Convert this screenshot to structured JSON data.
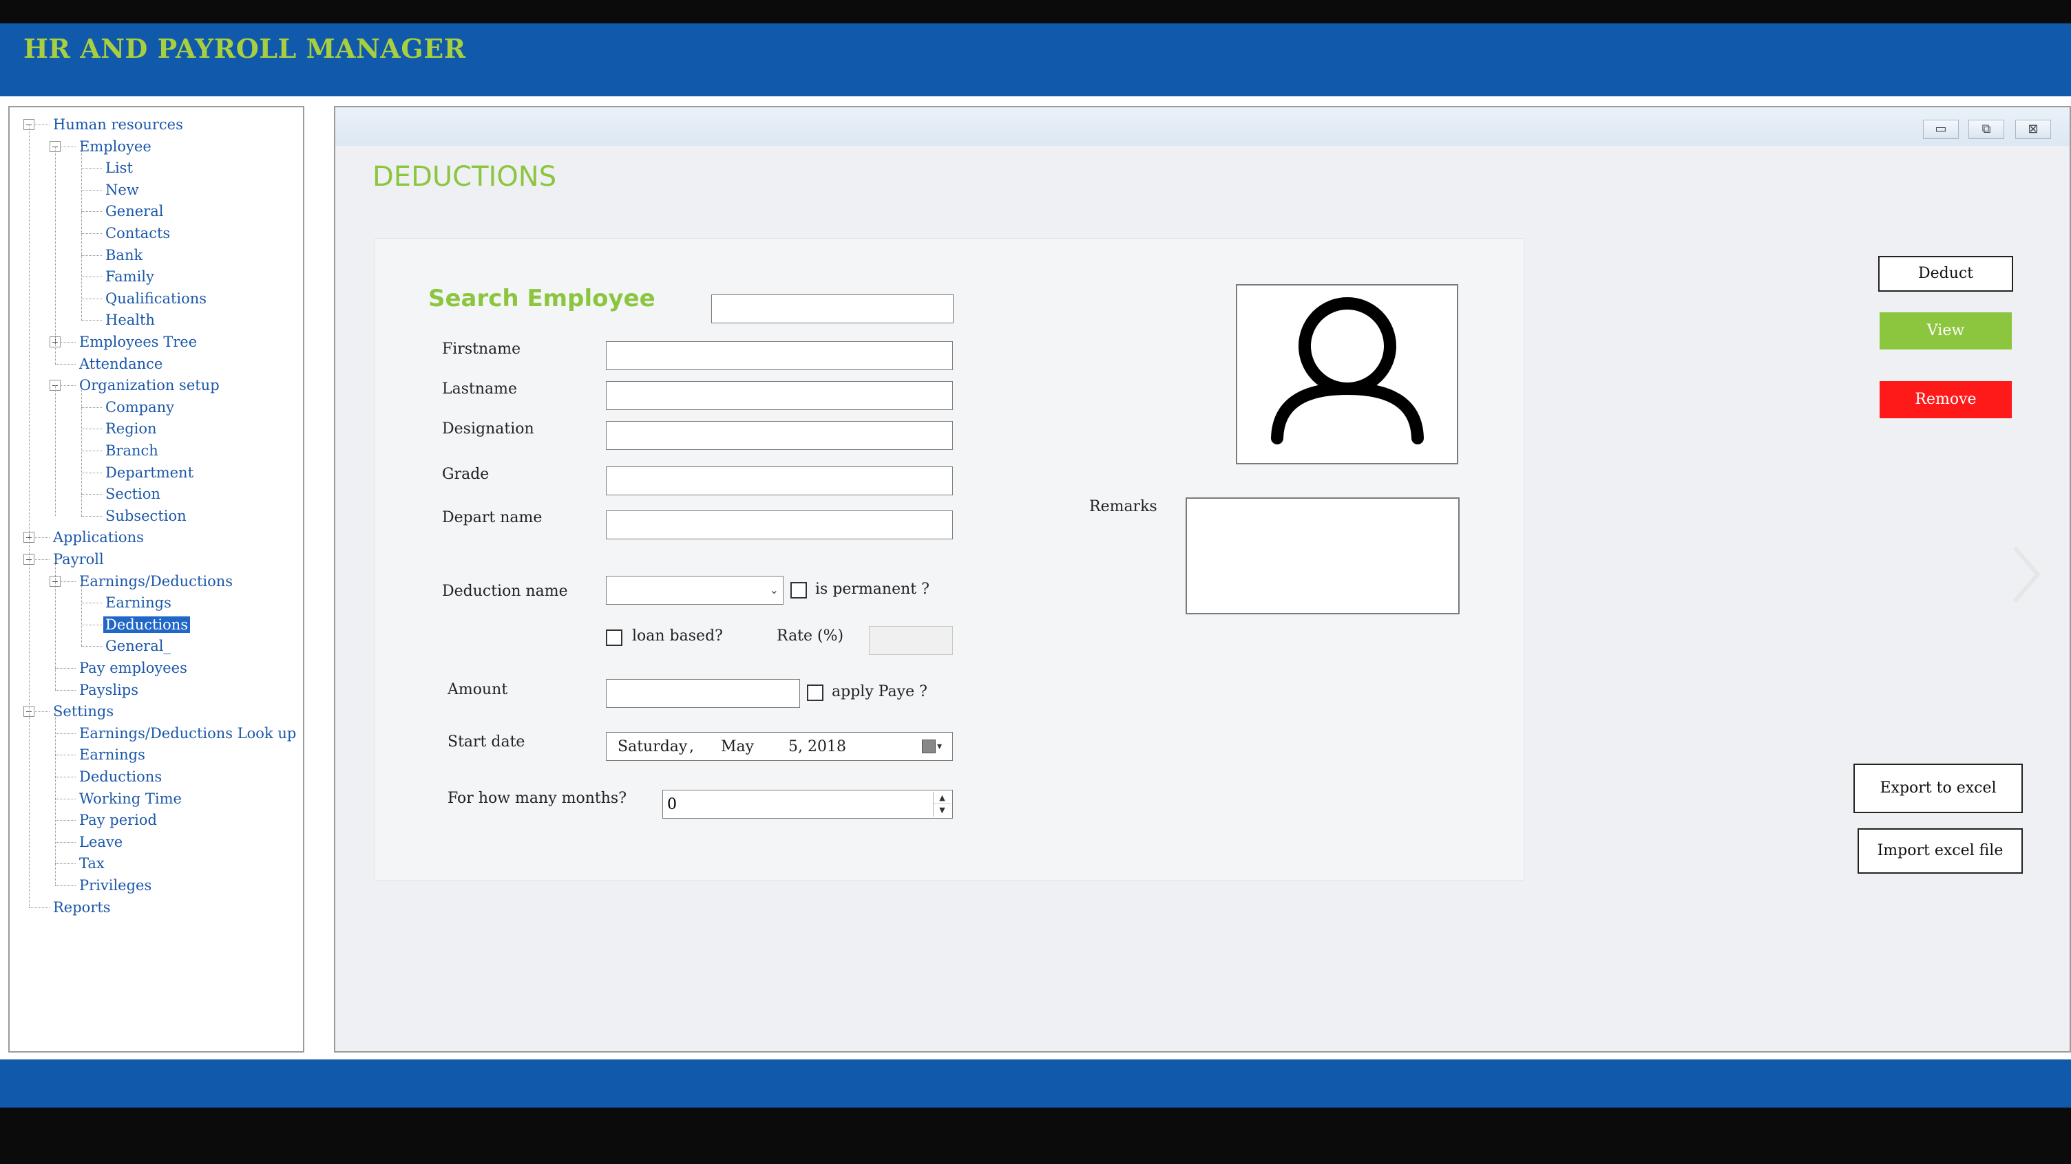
{
  "app": {
    "title": "HR AND PAYROLL MANAGER",
    "colors": {
      "header": "#1059ab",
      "accent": "#8cc63f",
      "danger": "#ff1a1a",
      "selection": "#2167c8",
      "tree_text": "#1b57a8"
    }
  },
  "tree": {
    "items": [
      {
        "label": "Human resources",
        "expander": "minus"
      },
      {
        "label": "Employee",
        "expander": "minus"
      },
      {
        "label": "List"
      },
      {
        "label": "New"
      },
      {
        "label": "General"
      },
      {
        "label": "Contacts"
      },
      {
        "label": "Bank"
      },
      {
        "label": "Family"
      },
      {
        "label": "Qualifications"
      },
      {
        "label": "Health"
      },
      {
        "label": "Employees Tree",
        "expander": "plus"
      },
      {
        "label": "Attendance"
      },
      {
        "label": "Organization setup",
        "expander": "minus"
      },
      {
        "label": "Company"
      },
      {
        "label": "Region"
      },
      {
        "label": "Branch"
      },
      {
        "label": "Department"
      },
      {
        "label": "Section"
      },
      {
        "label": "Subsection"
      },
      {
        "label": "Applications",
        "expander": "plus"
      },
      {
        "label": "Payroll",
        "expander": "minus"
      },
      {
        "label": "Earnings/Deductions",
        "expander": "minus"
      },
      {
        "label": "Earnings"
      },
      {
        "label": "Deductions",
        "selected": true
      },
      {
        "label": "General_"
      },
      {
        "label": "Pay employees"
      },
      {
        "label": "Payslips"
      },
      {
        "label": "Settings",
        "expander": "minus"
      },
      {
        "label": "Earnings/Deductions Look up"
      },
      {
        "label": "Earnings"
      },
      {
        "label": "Deductions"
      },
      {
        "label": "Working Time"
      },
      {
        "label": "Pay period"
      },
      {
        "label": "Leave"
      },
      {
        "label": "Tax"
      },
      {
        "label": "Privileges"
      },
      {
        "label": "Reports"
      }
    ]
  },
  "window": {
    "minimize_icon": "minimize-icon",
    "maximize_icon": "maximize-icon",
    "close_icon": "close-icon",
    "minimize_glyph": "▭",
    "maximize_glyph": "⧉",
    "close_glyph": "⊠"
  },
  "page": {
    "title": "DEDUCTIONS"
  },
  "form": {
    "search_label": "Search Employee",
    "search_value": "",
    "firstname": {
      "label": "Firstname",
      "value": ""
    },
    "lastname": {
      "label": "Lastname",
      "value": ""
    },
    "designation": {
      "label": "Designation",
      "value": ""
    },
    "grade": {
      "label": "Grade",
      "value": ""
    },
    "depart_name": {
      "label": "Depart name",
      "value": ""
    },
    "deduction_name": {
      "label": "Deduction name",
      "value": ""
    },
    "is_permanent": {
      "label": "is permanent ?",
      "checked": false
    },
    "loan_based": {
      "label": "loan based?",
      "checked": false
    },
    "rate": {
      "label": "Rate (%)",
      "value": ""
    },
    "amount": {
      "label": "Amount",
      "value": ""
    },
    "apply_paye": {
      "label": "apply Paye ?",
      "checked": false
    },
    "start_date": {
      "label": "Start date",
      "weekday": "Saturday",
      "sep": ",",
      "month": "May",
      "day_year": "5, 2018"
    },
    "months": {
      "label": "For how many months?",
      "value": "0"
    },
    "remarks": {
      "label": "Remarks",
      "value": ""
    }
  },
  "photo": {
    "icon": "user-avatar-icon"
  },
  "actions": {
    "deduct": "Deduct",
    "view": "View",
    "remove": "Remove",
    "export": "Export to excel",
    "import": "Import excel file"
  },
  "nav": {
    "next_icon": "chevron-right-icon"
  }
}
